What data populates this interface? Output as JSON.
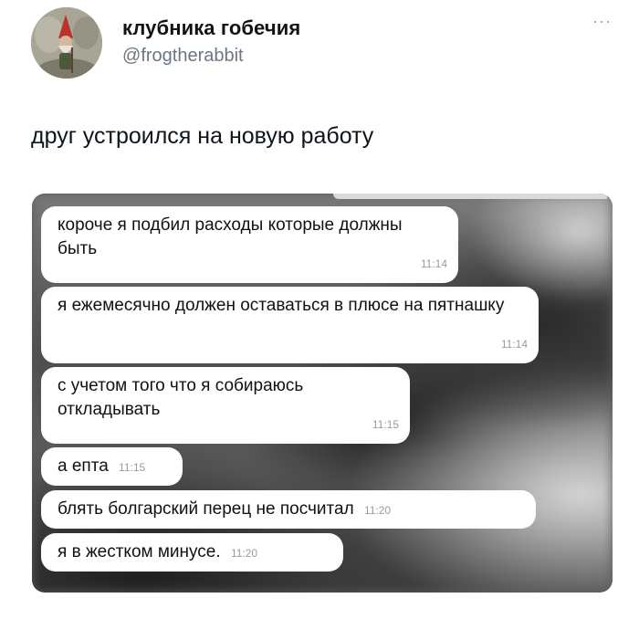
{
  "tweet": {
    "display_name": "клубника гобечия",
    "handle": "@frogtherabbit",
    "more_icon": "more-dots-icon",
    "text": "друг устроился на новую работу"
  },
  "chat": {
    "messages": [
      {
        "text": "короче я подбил расходы которые должны быть",
        "time": "11:14"
      },
      {
        "text": "я ежемесячно должен оставаться в плюсе на пятнашку",
        "time": "11:14"
      },
      {
        "text": "с учетом того что я собираюсь откладывать",
        "time": "11:15"
      },
      {
        "text": "а епта",
        "time": "11:15"
      },
      {
        "text": "блять болгарский перец не посчитал",
        "time": "11:20"
      },
      {
        "text": "я в жестком минусе.",
        "time": "11:20"
      }
    ]
  },
  "colors": {
    "name_text": "#0f1419",
    "handle_text": "#6b7680",
    "bubble_bg": "#ffffff",
    "time_text": "#9a9a9a"
  }
}
